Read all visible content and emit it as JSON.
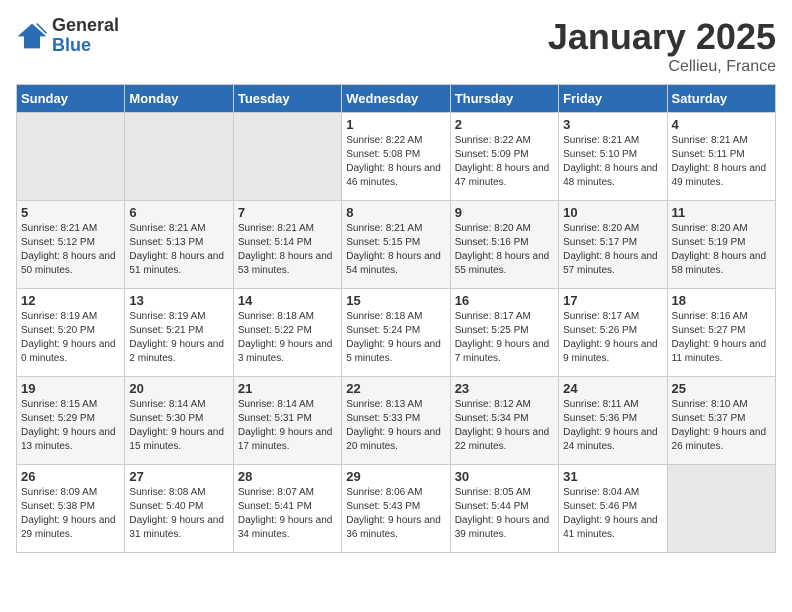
{
  "logo": {
    "general": "General",
    "blue": "Blue"
  },
  "title": "January 2025",
  "location": "Cellieu, France",
  "days_header": [
    "Sunday",
    "Monday",
    "Tuesday",
    "Wednesday",
    "Thursday",
    "Friday",
    "Saturday"
  ],
  "weeks": [
    [
      {
        "num": "",
        "empty": true
      },
      {
        "num": "",
        "empty": true
      },
      {
        "num": "",
        "empty": true
      },
      {
        "num": "1",
        "sunrise": "8:22 AM",
        "sunset": "5:08 PM",
        "daylight": "8 hours and 46 minutes."
      },
      {
        "num": "2",
        "sunrise": "8:22 AM",
        "sunset": "5:09 PM",
        "daylight": "8 hours and 47 minutes."
      },
      {
        "num": "3",
        "sunrise": "8:21 AM",
        "sunset": "5:10 PM",
        "daylight": "8 hours and 48 minutes."
      },
      {
        "num": "4",
        "sunrise": "8:21 AM",
        "sunset": "5:11 PM",
        "daylight": "8 hours and 49 minutes."
      }
    ],
    [
      {
        "num": "5",
        "sunrise": "8:21 AM",
        "sunset": "5:12 PM",
        "daylight": "8 hours and 50 minutes."
      },
      {
        "num": "6",
        "sunrise": "8:21 AM",
        "sunset": "5:13 PM",
        "daylight": "8 hours and 51 minutes."
      },
      {
        "num": "7",
        "sunrise": "8:21 AM",
        "sunset": "5:14 PM",
        "daylight": "8 hours and 53 minutes."
      },
      {
        "num": "8",
        "sunrise": "8:21 AM",
        "sunset": "5:15 PM",
        "daylight": "8 hours and 54 minutes."
      },
      {
        "num": "9",
        "sunrise": "8:20 AM",
        "sunset": "5:16 PM",
        "daylight": "8 hours and 55 minutes."
      },
      {
        "num": "10",
        "sunrise": "8:20 AM",
        "sunset": "5:17 PM",
        "daylight": "8 hours and 57 minutes."
      },
      {
        "num": "11",
        "sunrise": "8:20 AM",
        "sunset": "5:19 PM",
        "daylight": "8 hours and 58 minutes."
      }
    ],
    [
      {
        "num": "12",
        "sunrise": "8:19 AM",
        "sunset": "5:20 PM",
        "daylight": "9 hours and 0 minutes."
      },
      {
        "num": "13",
        "sunrise": "8:19 AM",
        "sunset": "5:21 PM",
        "daylight": "9 hours and 2 minutes."
      },
      {
        "num": "14",
        "sunrise": "8:18 AM",
        "sunset": "5:22 PM",
        "daylight": "9 hours and 3 minutes."
      },
      {
        "num": "15",
        "sunrise": "8:18 AM",
        "sunset": "5:24 PM",
        "daylight": "9 hours and 5 minutes."
      },
      {
        "num": "16",
        "sunrise": "8:17 AM",
        "sunset": "5:25 PM",
        "daylight": "9 hours and 7 minutes."
      },
      {
        "num": "17",
        "sunrise": "8:17 AM",
        "sunset": "5:26 PM",
        "daylight": "9 hours and 9 minutes."
      },
      {
        "num": "18",
        "sunrise": "8:16 AM",
        "sunset": "5:27 PM",
        "daylight": "9 hours and 11 minutes."
      }
    ],
    [
      {
        "num": "19",
        "sunrise": "8:15 AM",
        "sunset": "5:29 PM",
        "daylight": "9 hours and 13 minutes."
      },
      {
        "num": "20",
        "sunrise": "8:14 AM",
        "sunset": "5:30 PM",
        "daylight": "9 hours and 15 minutes."
      },
      {
        "num": "21",
        "sunrise": "8:14 AM",
        "sunset": "5:31 PM",
        "daylight": "9 hours and 17 minutes."
      },
      {
        "num": "22",
        "sunrise": "8:13 AM",
        "sunset": "5:33 PM",
        "daylight": "9 hours and 20 minutes."
      },
      {
        "num": "23",
        "sunrise": "8:12 AM",
        "sunset": "5:34 PM",
        "daylight": "9 hours and 22 minutes."
      },
      {
        "num": "24",
        "sunrise": "8:11 AM",
        "sunset": "5:36 PM",
        "daylight": "9 hours and 24 minutes."
      },
      {
        "num": "25",
        "sunrise": "8:10 AM",
        "sunset": "5:37 PM",
        "daylight": "9 hours and 26 minutes."
      }
    ],
    [
      {
        "num": "26",
        "sunrise": "8:09 AM",
        "sunset": "5:38 PM",
        "daylight": "9 hours and 29 minutes."
      },
      {
        "num": "27",
        "sunrise": "8:08 AM",
        "sunset": "5:40 PM",
        "daylight": "9 hours and 31 minutes."
      },
      {
        "num": "28",
        "sunrise": "8:07 AM",
        "sunset": "5:41 PM",
        "daylight": "9 hours and 34 minutes."
      },
      {
        "num": "29",
        "sunrise": "8:06 AM",
        "sunset": "5:43 PM",
        "daylight": "9 hours and 36 minutes."
      },
      {
        "num": "30",
        "sunrise": "8:05 AM",
        "sunset": "5:44 PM",
        "daylight": "9 hours and 39 minutes."
      },
      {
        "num": "31",
        "sunrise": "8:04 AM",
        "sunset": "5:46 PM",
        "daylight": "9 hours and 41 minutes."
      },
      {
        "num": "",
        "empty": true
      }
    ]
  ],
  "labels": {
    "sunrise": "Sunrise:",
    "sunset": "Sunset:",
    "daylight": "Daylight:"
  }
}
